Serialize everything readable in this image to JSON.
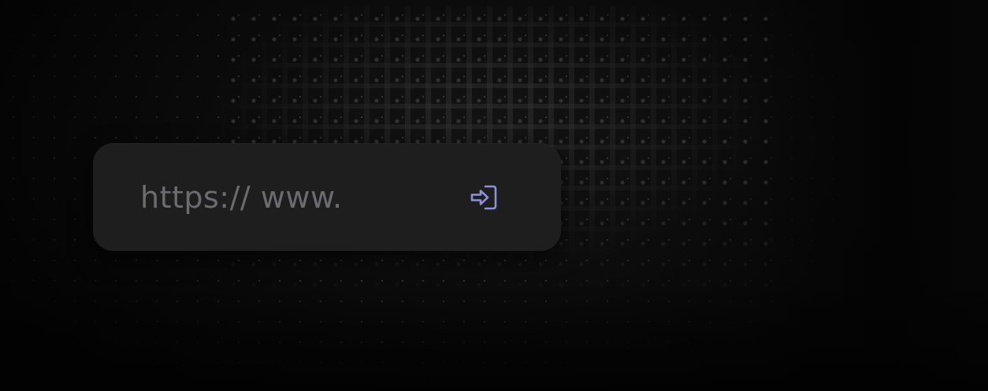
{
  "url_bar": {
    "placeholder": "https:// www.",
    "value": ""
  },
  "go_button": {
    "icon": "login-arrow-icon",
    "color": "#8e90d8"
  },
  "theme": {
    "background": "#050505",
    "bar_background": "#1e1e1f",
    "placeholder_color": "#6c6c6e"
  }
}
